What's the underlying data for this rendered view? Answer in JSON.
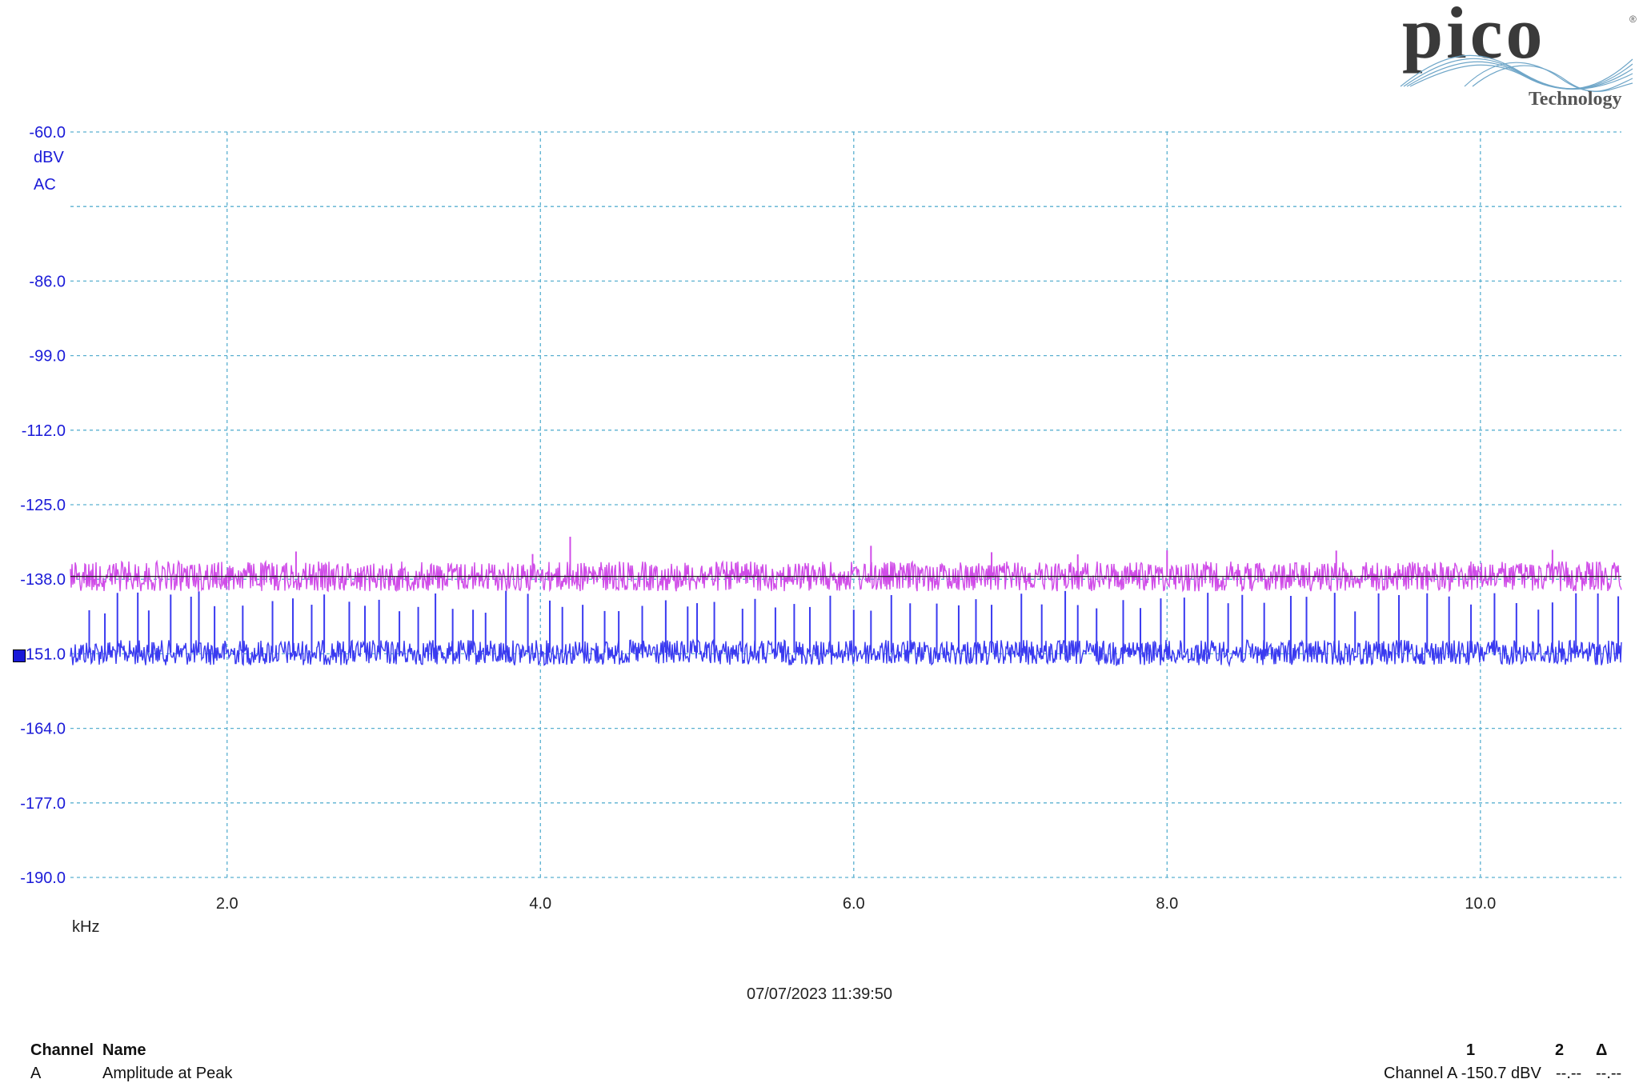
{
  "brand": {
    "name": "pico",
    "tagline": "Technology"
  },
  "y_unit": "dBV",
  "coupling": "AC",
  "x_unit": "kHz",
  "timestamp": "07/07/2023 11:39:50",
  "colors": {
    "grid": "#5ab0d0",
    "axis_text": "#1a1ad8",
    "series_a": "#3a3af0",
    "series_b": "#d04ce8",
    "ref_line": "#202020"
  },
  "chart_data": {
    "type": "line",
    "title": "",
    "xlabel": "kHz",
    "ylabel": "dBV",
    "xlim": [
      1.0,
      10.9
    ],
    "ylim": [
      -190.0,
      -60.0
    ],
    "grid": true,
    "x_ticks": [
      2.0,
      4.0,
      6.0,
      8.0,
      10.0
    ],
    "x_tick_labels": [
      "2.0",
      "4.0",
      "6.0",
      "8.0",
      "10.0"
    ],
    "y_ticks": [
      -60.0,
      -86.0,
      -99.0,
      -112.0,
      -125.0,
      -138.0,
      -151.0,
      -164.0,
      -177.0,
      -190.0
    ],
    "y_tick_labels": [
      "-60.0",
      "-86.0",
      "-99.0",
      "-112.0",
      "-125.0",
      "-138.0",
      "-151.0",
      "-164.0",
      "-177.0",
      "-190.0"
    ],
    "extra_gridlines_y": [
      -73.0
    ],
    "series": [
      {
        "key": "upper",
        "baseline": -137.5,
        "noise": 2.6,
        "spike_top": -130.5,
        "spikes_x": [
          2.44,
          3.95,
          4.19,
          6.11,
          6.88,
          7.43,
          8.0,
          9.08,
          10.46
        ]
      },
      {
        "key": "lower",
        "baseline": -150.8,
        "noise": 2.2,
        "spike_top": -140.0,
        "spikes_x": [
          1.12,
          1.22,
          1.3,
          1.43,
          1.5,
          1.64,
          1.77,
          1.82,
          1.92,
          2.1,
          2.29,
          2.42,
          2.54,
          2.62,
          2.78,
          2.88,
          2.97,
          3.1,
          3.22,
          3.33,
          3.44,
          3.57,
          3.65,
          3.78,
          3.92,
          4.06,
          4.14,
          4.27,
          4.41,
          4.5,
          4.65,
          4.8,
          4.94,
          5.0,
          5.11,
          5.29,
          5.37,
          5.5,
          5.62,
          5.72,
          5.85,
          6.0,
          6.11,
          6.24,
          6.36,
          6.53,
          6.67,
          6.78,
          6.88,
          7.07,
          7.2,
          7.35,
          7.43,
          7.55,
          7.72,
          7.83,
          7.96,
          8.11,
          8.26,
          8.39,
          8.48,
          8.62,
          8.79,
          8.89,
          9.07,
          9.2,
          9.35,
          9.48,
          9.66,
          9.8,
          9.94,
          10.09,
          10.23,
          10.37,
          10.46,
          10.61,
          10.75,
          10.88
        ]
      }
    ],
    "reference_line_y": -137.5
  },
  "measurements": {
    "headers": {
      "channel": "Channel",
      "name": "Name",
      "c1": "1",
      "c2": "2",
      "delta": "Δ"
    },
    "rows": [
      {
        "channel": "A",
        "name": "Amplitude at Peak",
        "c1": "Channel A -150.7 dBV",
        "c2": "--.--",
        "delta": "--.--"
      }
    ]
  }
}
